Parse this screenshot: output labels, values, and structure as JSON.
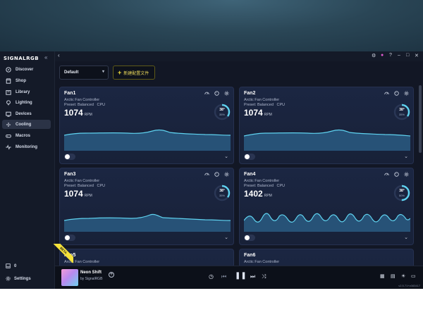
{
  "brand": "SIGNALRGB",
  "sidebar": {
    "items": [
      {
        "label": "Discover",
        "icon": "compass-icon"
      },
      {
        "label": "Shop",
        "icon": "shop-icon"
      },
      {
        "label": "Library",
        "icon": "library-icon"
      },
      {
        "label": "Lighting",
        "icon": "bulb-icon"
      },
      {
        "label": "Devices",
        "icon": "devices-icon"
      },
      {
        "label": "Cooling",
        "icon": "fan-icon",
        "active": true
      },
      {
        "label": "Macros",
        "icon": "gamepad-icon"
      },
      {
        "label": "Monitoring",
        "icon": "pulse-icon"
      }
    ],
    "notifications_count": "0",
    "settings_label": "Settings"
  },
  "toolbar": {
    "profile_value": "Default",
    "new_config_label": "新建配置文件"
  },
  "fans": [
    {
      "name": "Fan1",
      "controller": "Arctic Fan Controller",
      "preset": "Preset: Balanced",
      "source": "CPU",
      "rpm": "1074",
      "rpm_unit": "RPM",
      "temp": "38°",
      "percent": "35%",
      "level": 0.35
    },
    {
      "name": "Fan2",
      "controller": "Arctic Fan Controller",
      "preset": "Preset: Balanced",
      "source": "CPU",
      "rpm": "1074",
      "rpm_unit": "RPM",
      "temp": "38°",
      "percent": "35%",
      "level": 0.35
    },
    {
      "name": "Fan3",
      "controller": "Arctic Fan Controller",
      "preset": "Preset: Balanced",
      "source": "CPU",
      "rpm": "1074",
      "rpm_unit": "RPM",
      "temp": "38°",
      "percent": "35%",
      "level": 0.35
    },
    {
      "name": "Fan4",
      "controller": "Arctic Fan Controller",
      "preset": "Preset: Balanced",
      "source": "CPU",
      "rpm": "1402",
      "rpm_unit": "RPM",
      "temp": "38°",
      "percent": "50%",
      "level": 0.5
    },
    {
      "name": "Fan5",
      "controller": "Arctic Fan Controller"
    },
    {
      "name": "Fan6",
      "controller": "Arctic Fan Controller"
    }
  ],
  "player": {
    "track": "Neon Shift",
    "artist": "by SignalRGB",
    "beta_label": "BETA",
    "version": "v2.5.71+c083417"
  },
  "colors": {
    "accent_cyan": "#5fd3f0",
    "accent_yellow": "#f2de3c",
    "bg": "#121725"
  }
}
